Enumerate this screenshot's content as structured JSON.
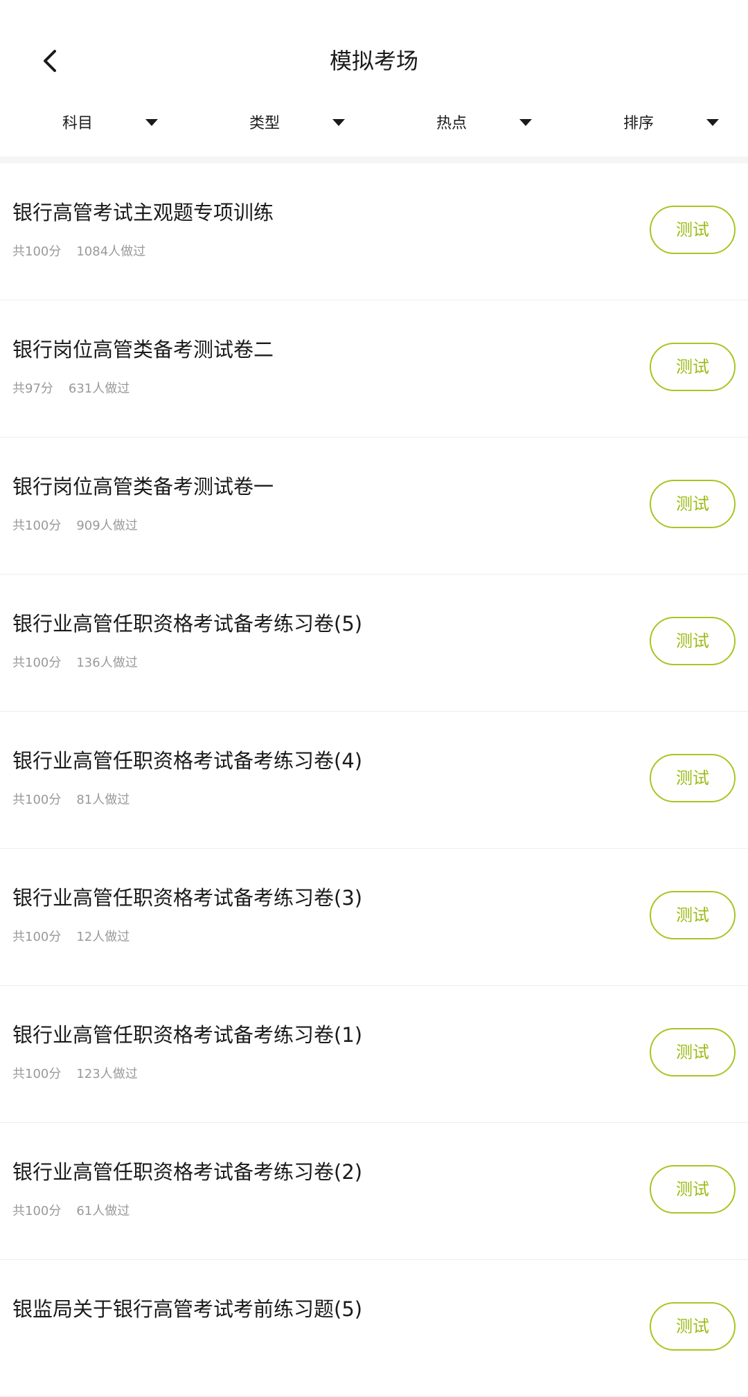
{
  "header": {
    "title": "模拟考场"
  },
  "filters": [
    {
      "label": "科目"
    },
    {
      "label": "类型"
    },
    {
      "label": "热点"
    },
    {
      "label": "排序"
    }
  ],
  "list": [
    {
      "title": "银行高管考试主观题专项训练",
      "score": "共100分",
      "done": "1084人做过",
      "button": "测试"
    },
    {
      "title": "银行岗位高管类备考测试卷二",
      "score": "共97分",
      "done": "631人做过",
      "button": "测试"
    },
    {
      "title": "银行岗位高管类备考测试卷一",
      "score": "共100分",
      "done": "909人做过",
      "button": "测试"
    },
    {
      "title": "银行业高管任职资格考试备考练习卷(5)",
      "score": "共100分",
      "done": "136人做过",
      "button": "测试"
    },
    {
      "title": "银行业高管任职资格考试备考练习卷(4)",
      "score": "共100分",
      "done": "81人做过",
      "button": "测试"
    },
    {
      "title": "银行业高管任职资格考试备考练习卷(3)",
      "score": "共100分",
      "done": "12人做过",
      "button": "测试"
    },
    {
      "title": "银行业高管任职资格考试备考练习卷(1)",
      "score": "共100分",
      "done": "123人做过",
      "button": "测试"
    },
    {
      "title": "银行业高管任职资格考试备考练习卷(2)",
      "score": "共100分",
      "done": "61人做过",
      "button": "测试"
    },
    {
      "title": "银监局关于银行高管考试考前练习题(5)",
      "score": "",
      "done": "",
      "button": "测试"
    }
  ],
  "colors": {
    "accent": "#a7c520",
    "accent_text": "#9bbb14",
    "meta_text": "#999999"
  },
  "icons": {
    "back": "chevron-left-icon",
    "filter_caret": "caret-down-icon"
  }
}
